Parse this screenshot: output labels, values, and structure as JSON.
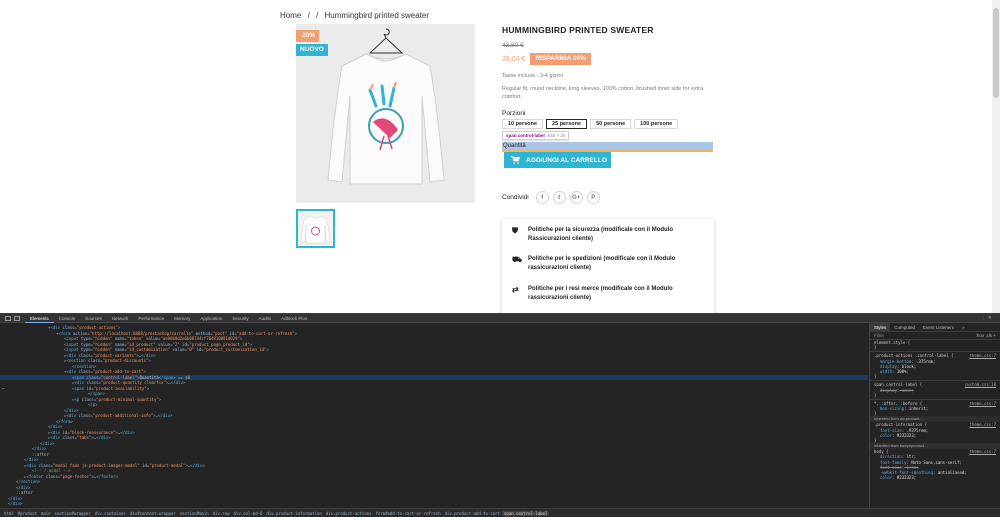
{
  "breadcrumb": {
    "home": "Home",
    "sep1": "/",
    "sep2": "/",
    "current": "Hummingbird printed sweater"
  },
  "product": {
    "flag_discount": "-20%",
    "flag_new": "NUOVO",
    "title": "HUMMINGBIRD PRINTED SWEATER",
    "old_price": "43,80 €",
    "price": "35,04 €",
    "save_label": "RISPARMIA 20%",
    "tax": "Tasse incluse - 3-4 giorni",
    "description": "Regular fit, round neckline, long sleeves. 100% cotton, brushed inner side for extra comfort.",
    "variant_label": "Porzioni",
    "variants": [
      "10 persone",
      "25 persone",
      "50 persone",
      "100 persone"
    ],
    "selected_variant": "25 persone",
    "quantity_label": "Quantità",
    "add_to_cart": "AGGIUNGI AL CARRELLO",
    "share_label": "Condividi",
    "share_icons": [
      "f",
      "t",
      "G+",
      "P"
    ],
    "reassurance": [
      {
        "icon": "shield-icon",
        "text": "Politiche per la sicurezza (modificale con il Modulo Rassicurazioni cliente)"
      },
      {
        "icon": "truck-icon",
        "text": "Politiche per le spedizioni (modificale con il Modulo rassicurazioni cliente)"
      },
      {
        "icon": "swap-icon",
        "text": "Politiche per i resi merce (modificale con il Modulo rassicurazioni cliente)"
      }
    ],
    "colors": {
      "accent": "#2fb5d2",
      "discount": "#f39d72"
    }
  },
  "inspector_tooltip": {
    "tag": "span.control-label",
    "size": "540 × 20"
  },
  "devtools": {
    "tabs": [
      "Elements",
      "Console",
      "Sources",
      "Network",
      "Performance",
      "Memory",
      "Application",
      "Security",
      "Audits",
      "Adblock Plus"
    ],
    "active_tab": "Elements",
    "dom_lines": [
      {
        "indent": 5,
        "html": "▾<span class='tg'>&lt;div</span> <span class='an'>class</span>=<span class='av'>\"product-actions\"</span><span class='tg'>&gt;</span>"
      },
      {
        "indent": 6,
        "html": "▾<span class='tg'>&lt;form</span> <span class='an'>action</span>=<span class='av'>\"http://localhost:8888/prestashop/carrello\"</span> <span class='an'>method</span>=<span class='av'>\"post\"</span> <span class='an'>id</span>=<span class='av'>\"add-to-cart-or-refresh\"</span><span class='tg'>&gt;</span>"
      },
      {
        "indent": 7,
        "html": "<span class='tg'>&lt;input</span> <span class='an'>type</span>=<span class='av'>\"hidden\"</span> <span class='an'>name</span>=<span class='av'>\"token\"</span> <span class='an'>value</span>=<span class='av'>\"ae90b9d2e6b08744cf764910891d029\"</span><span class='tg'>&gt;</span>"
      },
      {
        "indent": 7,
        "html": "<span class='tg'>&lt;input</span> <span class='an'>type</span>=<span class='av'>\"hidden\"</span> <span class='an'>name</span>=<span class='av'>\"id_product\"</span> <span class='an'>value</span>=<span class='av'>\"2\"</span> <span class='an'>id</span>=<span class='av'>\"product_page_product_id\"</span><span class='tg'>&gt;</span>"
      },
      {
        "indent": 7,
        "html": "<span class='tg'>&lt;input</span> <span class='an'>type</span>=<span class='av'>\"hidden\"</span> <span class='an'>name</span>=<span class='av'>\"id_customization\"</span> <span class='an'>value</span>=<span class='av'>\"0\"</span> <span class='an'>id</span>=<span class='av'>\"product_customization_id\"</span><span class='tg'>&gt;</span>"
      },
      {
        "indent": 7,
        "html": "▸<span class='tg'>&lt;div</span> <span class='an'>class</span>=<span class='av'>\"product-variants\"</span><span class='tg'>&gt;</span>…<span class='tg'>&lt;/div&gt;</span>"
      },
      {
        "indent": 7,
        "html": "▸<span class='tg'>&lt;section</span> <span class='an'>class</span>=<span class='av'>\"product-discounts\"</span><span class='tg'>&gt;</span>"
      },
      {
        "indent": 8,
        "html": "<span class='tg'>&lt;/section&gt;</span>"
      },
      {
        "indent": 7,
        "html": "▾<span class='tg'>&lt;div</span> <span class='an'>class</span>=<span class='av'>\"product-add-to-cart\"</span><span class='tg'>&gt;</span>"
      },
      {
        "indent": 8,
        "sel": true,
        "html": "<span class='tg'>&lt;span</span> <span class='an'>class</span>=<span class='av'>\"control-label\"</span><span class='tg'>&gt;</span><span class='tx'>Quantità</span><span class='tg'>&lt;/span&gt;</span> == $0"
      },
      {
        "indent": 8,
        "html": "▸<span class='tg'>&lt;div</span> <span class='an'>class</span>=<span class='av'>\"product-quantity clearfix\"</span><span class='tg'>&gt;</span>…<span class='tg'>&lt;/div&gt;</span>"
      },
      {
        "indent": 8,
        "html": "<span class='tg'>&lt;span</span> <span class='an'>id</span>=<span class='av'>\"product-availability\"</span><span class='tg'>&gt;</span>"
      },
      {
        "indent": 10,
        "html": "<span class='tg'>&lt;/span&gt;</span>"
      },
      {
        "indent": 8,
        "html": "▸<span class='tg'>&lt;p</span> <span class='an'>class</span>=<span class='av'>\"product-minimal-quantity\"</span><span class='tg'>&gt;</span>"
      },
      {
        "indent": 10,
        "html": "<span class='tg'>&lt;/p&gt;</span>"
      },
      {
        "indent": 7,
        "html": "<span class='tg'>&lt;/div&gt;</span>"
      },
      {
        "indent": 7,
        "html": "▸<span class='tg'>&lt;div</span> <span class='an'>class</span>=<span class='av'>\"product-additional-info\"</span><span class='tg'>&gt;</span>…<span class='tg'>&lt;/div&gt;</span>"
      },
      {
        "indent": 6,
        "html": "<span class='tg'>&lt;/form&gt;</span>"
      },
      {
        "indent": 5,
        "html": "<span class='tg'>&lt;/div&gt;</span>"
      },
      {
        "indent": 5,
        "html": "▸<span class='tg'>&lt;div</span> <span class='an'>id</span>=<span class='av'>\"block-reassurance\"</span><span class='tg'>&gt;</span>…<span class='tg'>&lt;/div&gt;</span>"
      },
      {
        "indent": 5,
        "html": "▸<span class='tg'>&lt;div</span> <span class='an'>class</span>=<span class='av'>\"tabs\"</span><span class='tg'>&gt;</span>…<span class='tg'>&lt;/div&gt;</span>"
      },
      {
        "indent": 4,
        "html": "<span class='tg'>&lt;/div&gt;</span>"
      },
      {
        "indent": 3,
        "html": "<span class='tg'>&lt;/div&gt;</span>"
      },
      {
        "indent": 3,
        "html": "::after"
      },
      {
        "indent": 2,
        "html": "<span class='tg'>&lt;/div&gt;</span>"
      },
      {
        "indent": 2,
        "html": "▸<span class='tg'>&lt;div</span> <span class='an'>class</span>=<span class='av'>\"modal fade js-product-images-modal\"</span> <span class='an'>id</span>=<span class='av'>\"product-modal\"</span><span class='tg'>&gt;</span>…<span class='tg'>&lt;/div&gt;</span>"
      },
      {
        "indent": 3,
        "html": "<span class='cm'>&lt;!-- /.modal --&gt;</span>"
      },
      {
        "indent": 2,
        "html": "▸<span class='tg'>&lt;footer</span> <span class='an'>class</span>=<span class='av'>\"page-footer\"</span><span class='tg'>&gt;</span>…<span class='tg'>&lt;/footer&gt;</span>"
      },
      {
        "indent": 1,
        "html": "<span class='tg'>&lt;/section&gt;</span>"
      },
      {
        "indent": 1,
        "html": "<span class='tg'>&lt;/div&gt;</span>"
      },
      {
        "indent": 1,
        "html": "::after"
      },
      {
        "indent": 0,
        "html": "<span class='tg'>&lt;/div&gt;</span>"
      },
      {
        "indent": 0,
        "html": "<span class='tg'>&lt;/div&gt;</span>"
      }
    ],
    "styles_tabs": [
      "Styles",
      "Computed",
      "Event Listeners",
      "»"
    ],
    "filter_placeholder": "Filter",
    "filter_right": ":hov .cls +",
    "style_rules": [
      {
        "kind": "sel",
        "text": "element.style {"
      },
      {
        "kind": "text",
        "text": "}"
      },
      {
        "kind": "sep"
      },
      {
        "kind": "sel",
        "text": ".product-actions .control-label {",
        "src": "theme.css:7"
      },
      {
        "kind": "prop",
        "name": "margin-bottom",
        "value": ".375rem;"
      },
      {
        "kind": "prop",
        "name": "display",
        "value": "block;"
      },
      {
        "kind": "prop",
        "name": "width",
        "value": "100%;"
      },
      {
        "kind": "text",
        "text": "}"
      },
      {
        "kind": "sep"
      },
      {
        "kind": "sel",
        "text": "span.control-label {",
        "src": "custom.css:10"
      },
      {
        "kind": "prop",
        "name": "display",
        "value": "none;",
        "strike": true
      },
      {
        "kind": "text",
        "text": "}"
      },
      {
        "kind": "sep"
      },
      {
        "kind": "sel",
        "text": "*, :after, :before {",
        "src": "theme.css:7"
      },
      {
        "kind": "prop",
        "name": "box-sizing",
        "value": "inherit;"
      },
      {
        "kind": "text",
        "text": "}"
      },
      {
        "kind": "inh",
        "text": "Inherited from div.product-…"
      },
      {
        "kind": "sel",
        "text": ".product-information {",
        "src": "theme.css:7"
      },
      {
        "kind": "prop",
        "name": "font-size",
        "value": ".9375rem;"
      },
      {
        "kind": "prop",
        "name": "color",
        "value": "#232323;"
      },
      {
        "kind": "text",
        "text": "}"
      },
      {
        "kind": "inh",
        "text": "Inherited from body#product…"
      },
      {
        "kind": "sel",
        "text": "body {",
        "src": "theme.css:7"
      },
      {
        "kind": "prop",
        "name": "direction",
        "value": "ltr;"
      },
      {
        "kind": "prop",
        "name": "font-family",
        "value": "Noto Sans,sans-serif;"
      },
      {
        "kind": "prop",
        "name": "font-size",
        "value": "1rem;",
        "strike": true
      },
      {
        "kind": "prop",
        "name": "-webkit-font-smoothing",
        "value": "antialiased;"
      },
      {
        "kind": "prop",
        "name": "color",
        "value": "#232323;"
      }
    ],
    "breadcrumbs": [
      "html",
      "#product",
      "main",
      "section#wrapper",
      "div.container",
      "div#content-wrapper",
      "section#main",
      "div.row",
      "div.col-md-6",
      "div.product-information",
      "div.product-actions",
      "form#add-to-cart-or-refresh",
      "div.product-add-to-cart",
      "span.control-label"
    ]
  }
}
